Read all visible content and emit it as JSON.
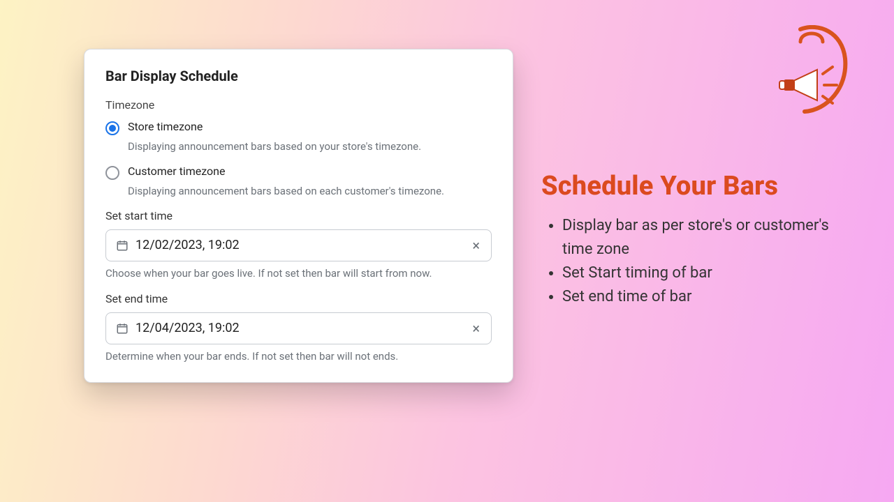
{
  "card": {
    "title": "Bar Display Schedule",
    "timezone": {
      "label": "Timezone",
      "store": {
        "label": "Store timezone",
        "desc": "Displaying announcement bars based on your store's timezone."
      },
      "customer": {
        "label": "Customer timezone",
        "desc": "Displaying announcement bars based on each customer's timezone."
      }
    },
    "start": {
      "label": "Set start time",
      "value": "12/02/2023, 19:02",
      "helper": "Choose when your bar goes live. If not set then bar will start from now."
    },
    "end": {
      "label": "Set end time",
      "value": "12/04/2023, 19:02",
      "helper": "Determine when your bar ends. If not set then bar will not ends."
    }
  },
  "promo": {
    "heading": "Schedule Your Bars",
    "bullets": {
      "0": "Display bar as per store's or customer's time zone",
      "1": "Set Start timing of bar",
      "2": "Set end time of bar"
    }
  }
}
